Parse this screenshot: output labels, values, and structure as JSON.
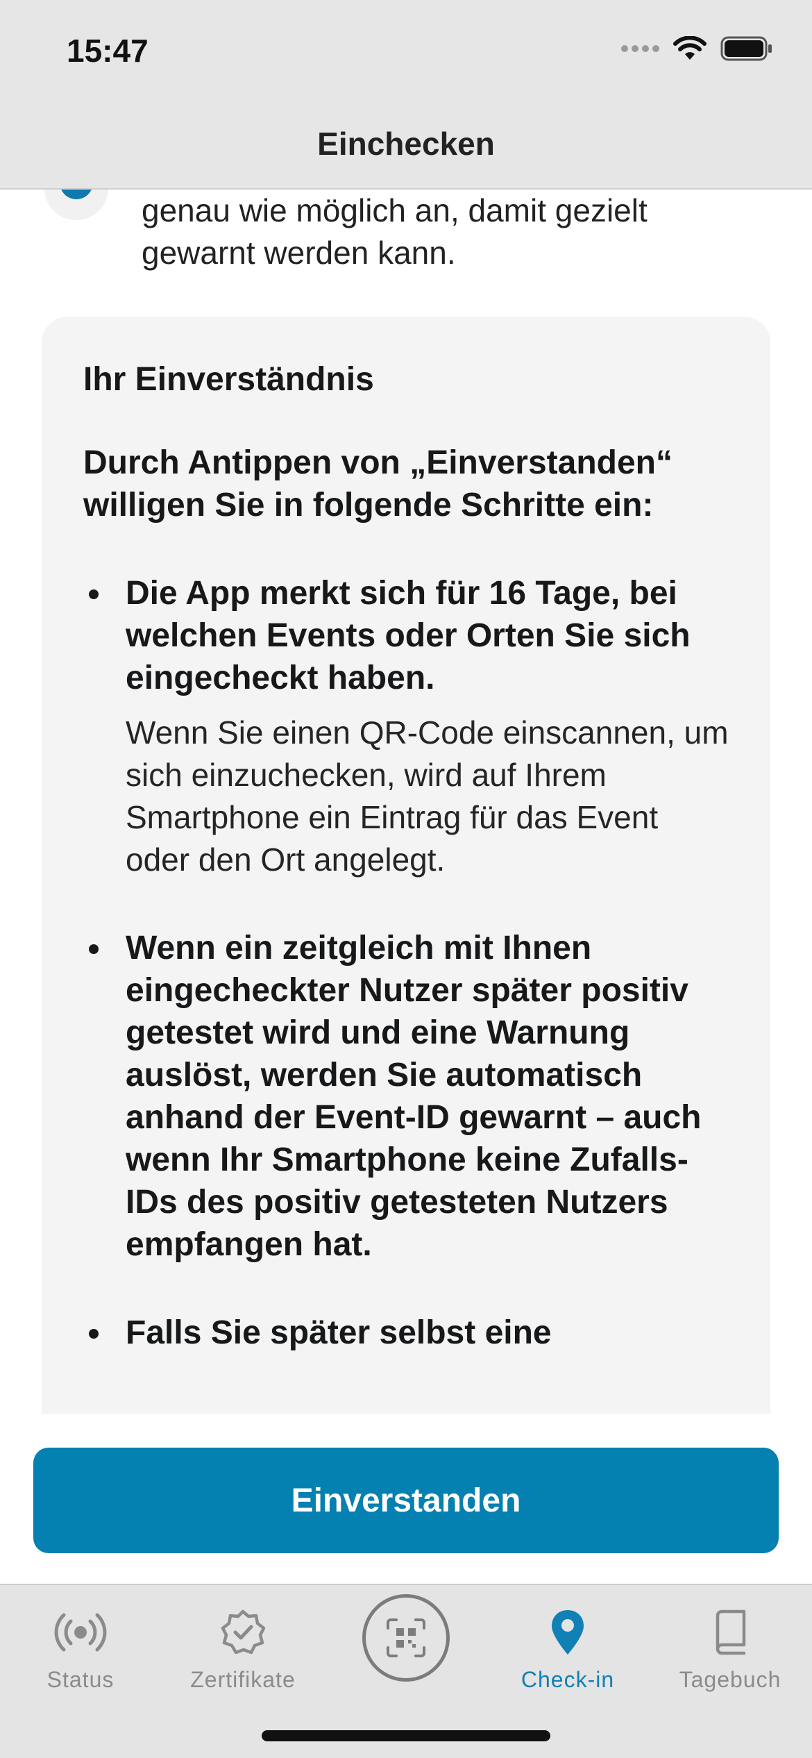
{
  "status_bar": {
    "time": "15:47"
  },
  "nav": {
    "title": "Einchecken"
  },
  "step": {
    "text": "genau wie möglich an, damit gezielt gewarnt werden kann."
  },
  "consent": {
    "title": "Ihr Einverständnis",
    "intro": "Durch Antippen von „Einverstanden“ willigen Sie in folgende Schritte ein:",
    "bullets": [
      {
        "heading": "Die App merkt sich für 16 Tage, bei welchen Events oder Orten Sie sich eingecheckt haben.",
        "description": "Wenn Sie einen QR-Code einscannen, um sich einzuchecken, wird auf Ihrem Smartphone ein Eintrag für das Event oder den Ort angelegt."
      },
      {
        "heading": "Wenn ein zeitgleich mit Ihnen eingecheckter Nutzer später positiv getestet wird und eine Warnung auslöst, werden Sie automatisch anhand der Event-ID gewarnt – auch wenn Ihr Smartphone keine Zufalls-IDs des positiv getesteten Nutzers empfangen hat."
      },
      {
        "heading": "Falls Sie später selbst eine"
      }
    ]
  },
  "footer": {
    "agree_label": "Einverstanden"
  },
  "tabbar": {
    "tabs": [
      {
        "label": "Status",
        "icon": "radar-icon"
      },
      {
        "label": "Zertifikate",
        "icon": "certificate-badge-icon"
      },
      {
        "label": "",
        "icon": "qr-scan-icon"
      },
      {
        "label": "Check-in",
        "icon": "location-pin-icon",
        "active": true
      },
      {
        "label": "Tagebuch",
        "icon": "book-icon"
      }
    ]
  },
  "colors": {
    "accent": "#0480b1",
    "tab_active": "#1180b5",
    "tab_inactive": "#8b8b8b",
    "card_bg": "#f4f4f4"
  }
}
